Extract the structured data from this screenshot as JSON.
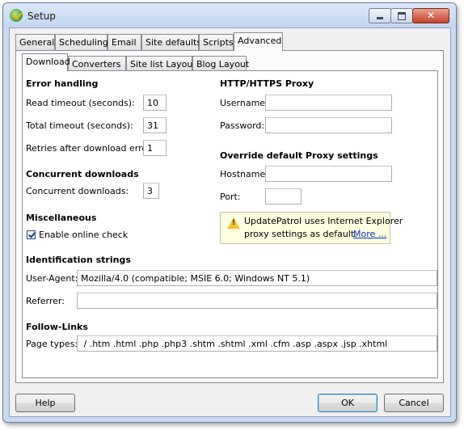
{
  "window": {
    "title": "Setup",
    "close_glyph": "✕"
  },
  "outer_tabs": [
    "General",
    "Scheduling",
    "Email",
    "Site defaults",
    "Scripts",
    "Advanced"
  ],
  "inner_tabs": [
    "Download",
    "Converters",
    "Site list Layout",
    "Blog Layout"
  ],
  "error_handling": {
    "header": "Error handling",
    "read_timeout_label": "Read timeout (seconds):",
    "read_timeout_value": "10",
    "total_timeout_label": "Total timeout (seconds):",
    "total_timeout_value": "31",
    "retries_label": "Retries after download error:",
    "retries_value": "1"
  },
  "concurrent": {
    "header": "Concurrent downloads",
    "label": "Concurrent downloads:",
    "value": "3"
  },
  "misc": {
    "header": "Miscellaneous",
    "online_check_label": "Enable online check",
    "online_check_checked": true
  },
  "proxy": {
    "header": "HTTP/HTTPS Proxy",
    "username_label": "Username:",
    "username_value": "",
    "password_label": "Password:",
    "password_value": ""
  },
  "override": {
    "header": "Override default Proxy settings",
    "hostname_label": "Hostname:",
    "hostname_value": "",
    "port_label": "Port:",
    "port_value": ""
  },
  "info": {
    "icon": "warning-icon",
    "line1": "UpdatePatrol uses Internet Explorer",
    "line2": "proxy settings as default.",
    "more_link": "More ..."
  },
  "identification": {
    "header": "Identification strings",
    "user_agent_label": "User-Agent:",
    "user_agent_value": "Mozilla/4.0 (compatible; MSIE 6.0; Windows NT 5.1)",
    "referrer_label": "Referrer:",
    "referrer_value": ""
  },
  "follow_links": {
    "header": "Follow-Links",
    "page_types_label": "Page types:",
    "page_types_value": " / .htm .html .php .php3 .shtm .shtml .xml .cfm .asp .aspx .jsp .xhtml"
  },
  "buttons": {
    "help": "Help",
    "ok": "OK",
    "cancel": "Cancel"
  }
}
